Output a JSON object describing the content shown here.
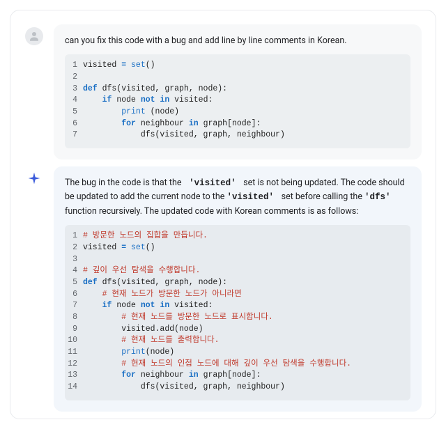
{
  "user_message": {
    "text": "can you fix this code with a bug and add line by line comments in Korean.",
    "code": [
      {
        "n": "1",
        "tokens": [
          [
            "ident",
            "visited "
          ],
          [
            "kw",
            "= "
          ],
          [
            "builtin",
            "set"
          ],
          [
            "ident",
            "()"
          ]
        ]
      },
      {
        "n": "2",
        "tokens": [
          [
            "ident",
            ""
          ]
        ]
      },
      {
        "n": "3",
        "tokens": [
          [
            "kw",
            "def "
          ],
          [
            "fn",
            "dfs"
          ],
          [
            "ident",
            "(visited, graph, node):"
          ]
        ]
      },
      {
        "n": "4",
        "tokens": [
          [
            "ident",
            "    "
          ],
          [
            "kw",
            "if "
          ],
          [
            "ident",
            "node "
          ],
          [
            "kw",
            "not in "
          ],
          [
            "ident",
            "visited:"
          ]
        ]
      },
      {
        "n": "5",
        "tokens": [
          [
            "ident",
            "        "
          ],
          [
            "builtin",
            "print"
          ],
          [
            "ident",
            " (node)"
          ]
        ]
      },
      {
        "n": "6",
        "tokens": [
          [
            "ident",
            "        "
          ],
          [
            "kw",
            "for "
          ],
          [
            "ident",
            "neighbour "
          ],
          [
            "kw",
            "in "
          ],
          [
            "ident",
            "graph[node]:"
          ]
        ]
      },
      {
        "n": "7",
        "tokens": [
          [
            "ident",
            "            dfs(visited, graph, neighbour)"
          ]
        ]
      }
    ]
  },
  "assistant_message": {
    "text_parts": [
      "The bug in the code is that the ",
      " 'visited' ",
      " set is not being updated. The code should be updated to add the current node to the ",
      "'visited' ",
      " set before calling the ",
      "'dfs' ",
      " function recursively. The updated code with Korean comments is as follows:"
    ],
    "code": [
      {
        "n": "1",
        "tokens": [
          [
            "cmt",
            "# 방문한 노드의 집합을 만듭니다."
          ]
        ]
      },
      {
        "n": "2",
        "tokens": [
          [
            "ident",
            "visited "
          ],
          [
            "kw",
            "= "
          ],
          [
            "builtin",
            "set"
          ],
          [
            "ident",
            "()"
          ]
        ]
      },
      {
        "n": "3",
        "tokens": [
          [
            "ident",
            ""
          ]
        ]
      },
      {
        "n": "4",
        "tokens": [
          [
            "cmt",
            "# 깊이 우선 탐색을 수행합니다."
          ]
        ]
      },
      {
        "n": "5",
        "tokens": [
          [
            "kw",
            "def "
          ],
          [
            "fn",
            "dfs"
          ],
          [
            "ident",
            "(visited, graph, node):"
          ]
        ]
      },
      {
        "n": "6",
        "tokens": [
          [
            "ident",
            "    "
          ],
          [
            "cmt",
            "# 현재 노드가 방문한 노드가 아니라면"
          ]
        ]
      },
      {
        "n": "7",
        "tokens": [
          [
            "ident",
            "    "
          ],
          [
            "kw",
            "if "
          ],
          [
            "ident",
            "node "
          ],
          [
            "kw",
            "not in "
          ],
          [
            "ident",
            "visited:"
          ]
        ]
      },
      {
        "n": "8",
        "tokens": [
          [
            "ident",
            "        "
          ],
          [
            "cmt",
            "# 현재 노드를 방문한 노드로 표시합니다."
          ]
        ]
      },
      {
        "n": "9",
        "tokens": [
          [
            "ident",
            "        visited.add(node)"
          ]
        ]
      },
      {
        "n": "10",
        "tokens": [
          [
            "ident",
            "        "
          ],
          [
            "cmt",
            "# 현재 노드를 출력합니다."
          ]
        ]
      },
      {
        "n": "11",
        "tokens": [
          [
            "ident",
            "        "
          ],
          [
            "builtin",
            "print"
          ],
          [
            "ident",
            "(node)"
          ]
        ]
      },
      {
        "n": "12",
        "tokens": [
          [
            "ident",
            "        "
          ],
          [
            "cmt",
            "# 현재 노드의 인접 노드에 대해 깊이 우선 탐색을 수행합니다."
          ]
        ]
      },
      {
        "n": "13",
        "tokens": [
          [
            "ident",
            "        "
          ],
          [
            "kw",
            "for "
          ],
          [
            "ident",
            "neighbour "
          ],
          [
            "kw",
            "in "
          ],
          [
            "ident",
            "graph[node]:"
          ]
        ]
      },
      {
        "n": "14",
        "tokens": [
          [
            "ident",
            "            dfs(visited, graph, neighbour)"
          ]
        ]
      }
    ]
  }
}
